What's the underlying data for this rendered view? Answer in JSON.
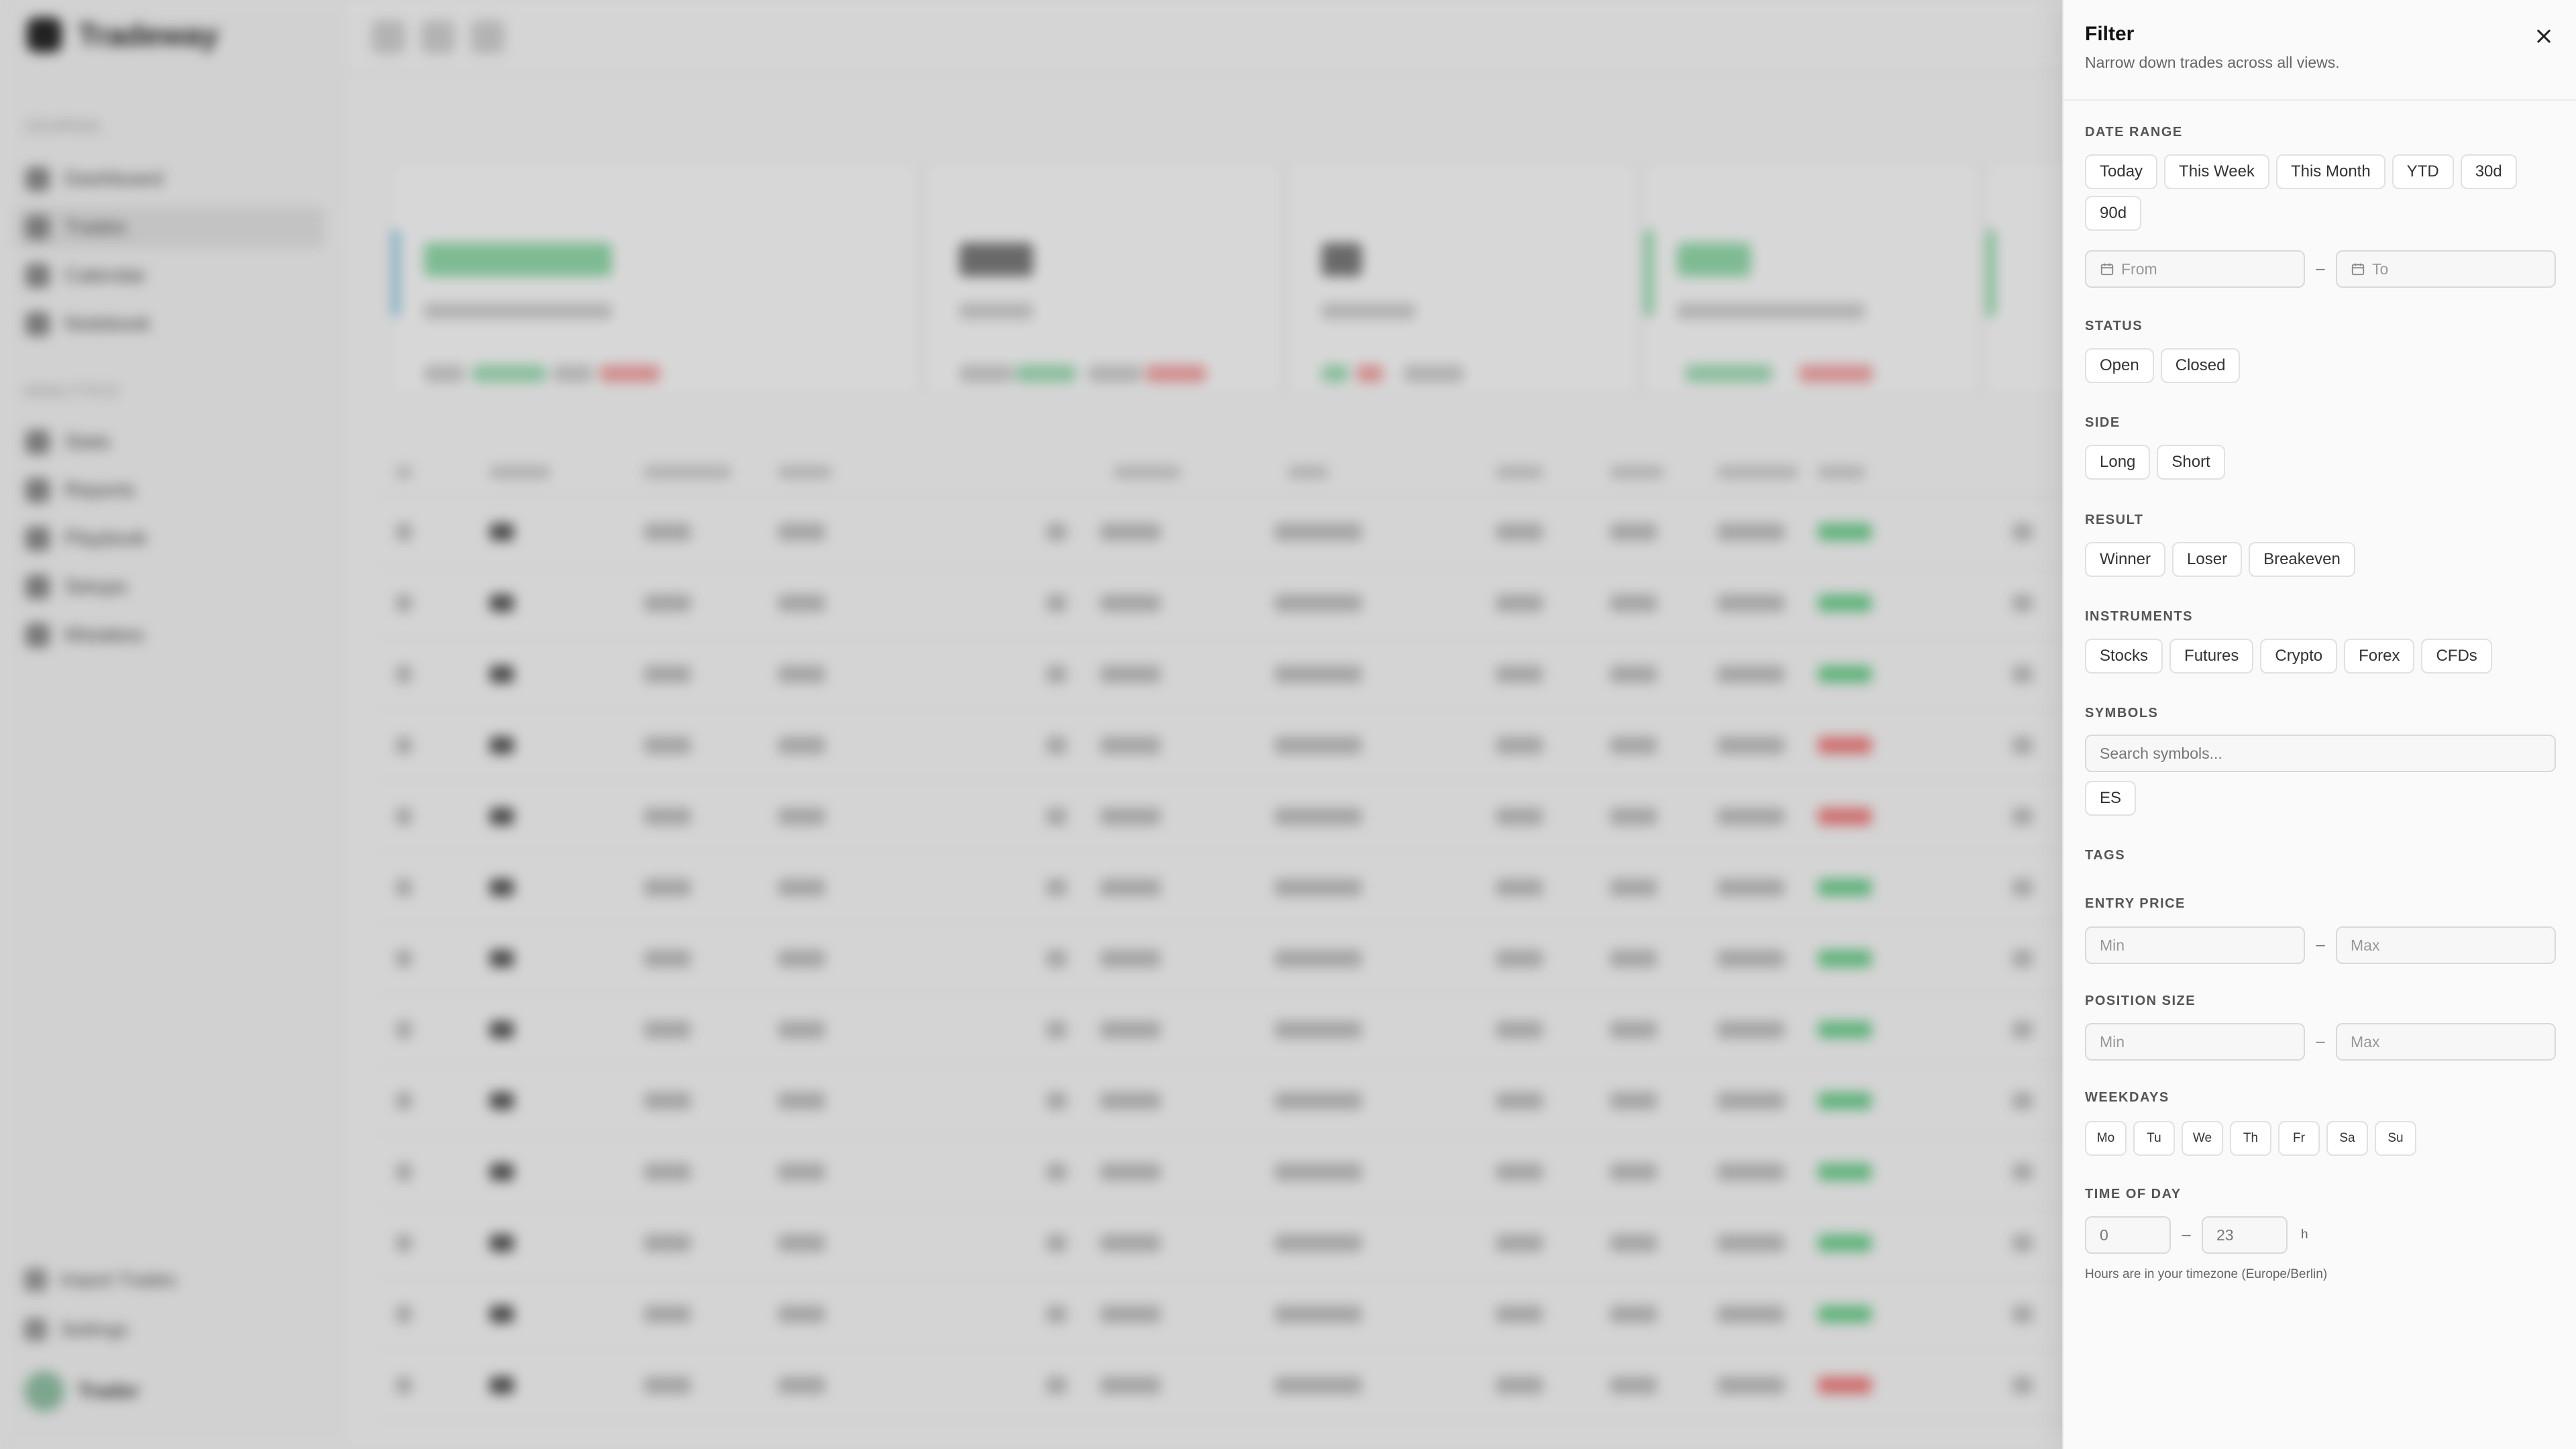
{
  "app": {
    "logo_text": "Tradeway",
    "nav_section_1": "JOURNAL",
    "nav_section_2": "ANALYTICS",
    "nav_items_1": [
      "Dashboard",
      "Trades",
      "Calendar",
      "Notebook"
    ],
    "nav_items_2": [
      "Stats",
      "Reports",
      "Playbook",
      "Setups",
      "Mistakes"
    ],
    "footer_items": [
      "Import Trades",
      "Settings"
    ],
    "user_name": "Trader"
  },
  "filter": {
    "title": "Filter",
    "description": "Narrow down trades across all views.",
    "date_range": {
      "label": "DATE RANGE",
      "options": [
        "Today",
        "This Week",
        "This Month",
        "YTD",
        "30d",
        "90d"
      ],
      "from_placeholder": "From",
      "to_placeholder": "To",
      "separator": "–"
    },
    "status": {
      "label": "STATUS",
      "options": [
        "Open",
        "Closed"
      ]
    },
    "side": {
      "label": "SIDE",
      "options": [
        "Long",
        "Short"
      ]
    },
    "result": {
      "label": "RESULT",
      "options": [
        "Winner",
        "Loser",
        "Breakeven"
      ]
    },
    "instruments": {
      "label": "INSTRUMENTS",
      "options": [
        "Stocks",
        "Futures",
        "Crypto",
        "Forex",
        "CFDs"
      ]
    },
    "symbols": {
      "label": "SYMBOLS",
      "placeholder": "Search symbols...",
      "options": [
        "ES"
      ]
    },
    "tags": {
      "label": "TAGS"
    },
    "entry_price": {
      "label": "ENTRY PRICE",
      "min_placeholder": "Min",
      "max_placeholder": "Max",
      "separator": "–"
    },
    "position_size": {
      "label": "POSITION SIZE",
      "min_placeholder": "Min",
      "max_placeholder": "Max",
      "separator": "–"
    },
    "weekdays": {
      "label": "WEEKDAYS",
      "options": [
        "Mo",
        "Tu",
        "We",
        "Th",
        "Fr",
        "Sa",
        "Su"
      ]
    },
    "time_of_day": {
      "label": "TIME OF DAY",
      "from_value": "0",
      "to_value": "23",
      "separator": "–",
      "unit": "h",
      "hint": "Hours are in your timezone (Europe/Berlin)"
    }
  },
  "colors": {
    "profit": "#6fcf8f",
    "loss": "#ef8080",
    "panel_bg": "#fafafa"
  }
}
